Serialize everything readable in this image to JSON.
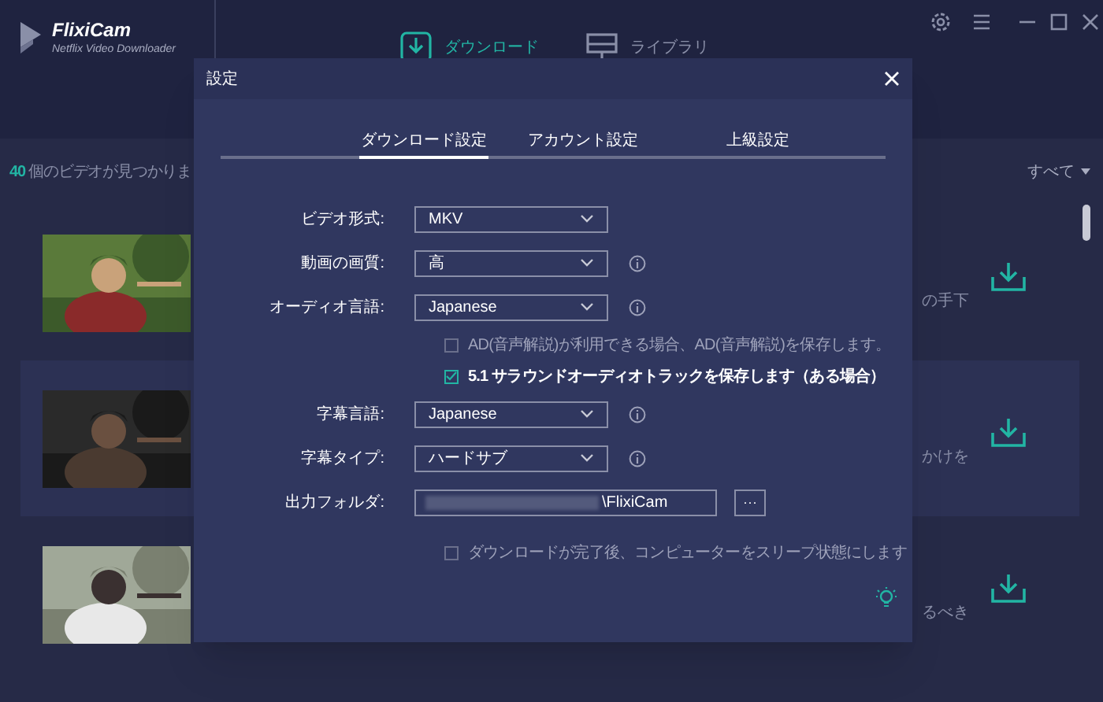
{
  "app": {
    "name": "FlixiCam",
    "subtitle": "Netflix Video Downloader"
  },
  "nav_tabs": [
    {
      "label": "ダウンロード",
      "selected": true
    },
    {
      "label": "ライブラリ",
      "selected": false
    }
  ],
  "results": {
    "count": "40",
    "text": "個のビデオが見つかりま",
    "filter": "すべて"
  },
  "videos": [
    {
      "snippet": "の手下",
      "selected": false
    },
    {
      "snippet": "かけを",
      "selected": true
    },
    {
      "snippet": "るべき",
      "selected": false
    }
  ],
  "dialog": {
    "title": "設定",
    "tabs": [
      {
        "label": "ダウンロード設定",
        "selected": true
      },
      {
        "label": "アカウント設定",
        "selected": false
      },
      {
        "label": "上級設定",
        "selected": false
      }
    ],
    "fields": [
      {
        "kind": "select",
        "label": "ビデオ形式:",
        "value": "MKV",
        "info": false
      },
      {
        "kind": "select",
        "label": "動画の画質:",
        "value": "高",
        "info": true
      },
      {
        "kind": "select",
        "label": "オーディオ言語:",
        "value": "Japanese",
        "info": true
      },
      {
        "kind": "checkbox",
        "label": "AD(音声解説)が利用できる場合、AD(音声解説)を保存します。",
        "checked": false
      },
      {
        "kind": "checkbox",
        "label": "5.1 サラウンドオーディオトラックを保存します（ある場合）",
        "checked": true
      },
      {
        "kind": "select",
        "label": "字幕言語:",
        "value": "Japanese",
        "info": true
      },
      {
        "kind": "select",
        "label": "字幕タイプ:",
        "value": "ハードサブ",
        "info": true
      },
      {
        "kind": "folder",
        "label": "出力フォルダ:",
        "value": "\\FlixiCam",
        "button": "···"
      },
      {
        "kind": "checkbox",
        "label": "ダウンロードが完了後、コンピューターをスリープ状態にします",
        "checked": false
      }
    ]
  }
}
